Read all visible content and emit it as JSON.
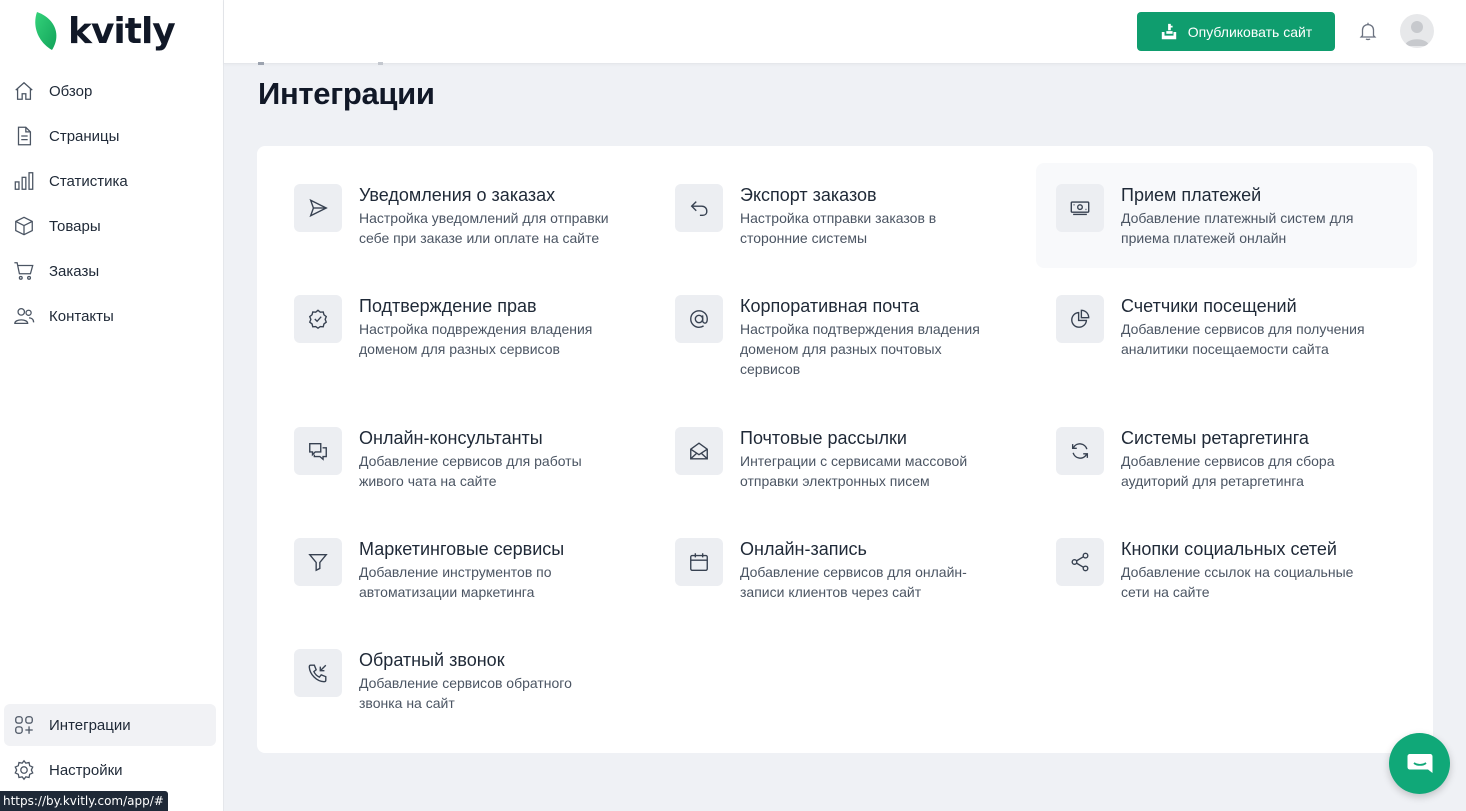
{
  "app": {
    "logo_text": "kvitly"
  },
  "sidebar": {
    "items": [
      {
        "label": "Обзор",
        "icon": "home-icon"
      },
      {
        "label": "Страницы",
        "icon": "document-icon"
      },
      {
        "label": "Статистика",
        "icon": "bar-chart-icon"
      },
      {
        "label": "Товары",
        "icon": "cube-icon"
      },
      {
        "label": "Заказы",
        "icon": "cart-icon"
      },
      {
        "label": "Контакты",
        "icon": "users-icon"
      }
    ],
    "bottom_items": [
      {
        "label": "Интеграции",
        "icon": "grid-plus-icon",
        "active": true
      },
      {
        "label": "Настройки",
        "icon": "gear-icon"
      }
    ]
  },
  "header": {
    "publish_label": "Опубликовать сайт",
    "publish_color": "#0f9d6e"
  },
  "page": {
    "title": "Интеграции"
  },
  "integrations": [
    {
      "title": "Уведомления о заказах",
      "desc": [
        "Настройка уведомлений для отправки",
        "себе при заказе или оплате на сайте"
      ],
      "icon": "send-icon"
    },
    {
      "title": "Экспорт заказов",
      "desc": [
        "Настройка отправки заказов в",
        "сторонние системы"
      ],
      "icon": "reply-icon"
    },
    {
      "title": "Прием платежей",
      "desc": [
        "Добавление платежный систем для",
        "приема платежей онлайн"
      ],
      "icon": "money-icon"
    },
    {
      "title": "Подтверждение прав",
      "desc": [
        "Настройка подвреждения владения",
        "доменом для разных сервисов"
      ],
      "icon": "badge-check-icon"
    },
    {
      "title": "Корпоративная почта",
      "desc": [
        "Настройка подтверждения владения",
        "доменом для разных почтовых",
        "сервисов"
      ],
      "icon": "at-sign-icon"
    },
    {
      "title": "Счетчики посещений",
      "desc": [
        "Добавление сервисов для получения",
        "аналитики посещаемости сайта"
      ],
      "icon": "pie-chart-icon"
    },
    {
      "title": "Онлайн-консультанты",
      "desc": [
        "Добавление сервисов для работы",
        "живого чата на сайте"
      ],
      "icon": "chat-bubbles-icon"
    },
    {
      "title": "Почтовые рассылки",
      "desc": [
        "Интеграции с сервисами массовой",
        "отправки электронных писем"
      ],
      "icon": "mail-open-icon"
    },
    {
      "title": "Системы ретаргетинга",
      "desc": [
        "Добавление сервисов для сбора",
        "аудиторий для ретаргетинга"
      ],
      "icon": "refresh-icon"
    },
    {
      "title": "Маркетинговые сервисы",
      "desc": [
        "Добавление инструментов по",
        "автоматизации маркетинга"
      ],
      "icon": "filter-icon"
    },
    {
      "title": "Онлайн-запись",
      "desc": [
        "Добавление сервисов для онлайн-",
        "записи клиентов через сайт"
      ],
      "icon": "calendar-icon"
    },
    {
      "title": "Кнопки социальных сетей",
      "desc": [
        "Добавление ссылок на социальные",
        "сети на сайте"
      ],
      "icon": "share-icon"
    },
    {
      "title": "Обратный звонок",
      "desc": [
        "Добавление сервисов обратного",
        "звонка на сайт"
      ],
      "icon": "phone-incoming-icon"
    }
  ],
  "status_bar": {
    "url": "https://by.kvitly.com/app/#"
  }
}
